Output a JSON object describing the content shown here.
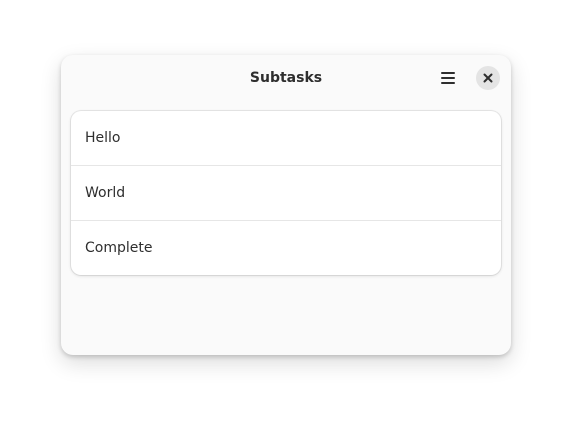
{
  "window": {
    "title": "Subtasks"
  },
  "header": {
    "menu_icon": "hamburger-menu-icon",
    "close_icon": "close-icon"
  },
  "list": {
    "items": [
      {
        "label": "Hello"
      },
      {
        "label": "World"
      },
      {
        "label": "Complete"
      }
    ]
  },
  "colors": {
    "window_bg": "#fafafa",
    "card_bg": "#ffffff",
    "close_button_bg": "#e4e4e4",
    "text": "#2e2e2e"
  }
}
